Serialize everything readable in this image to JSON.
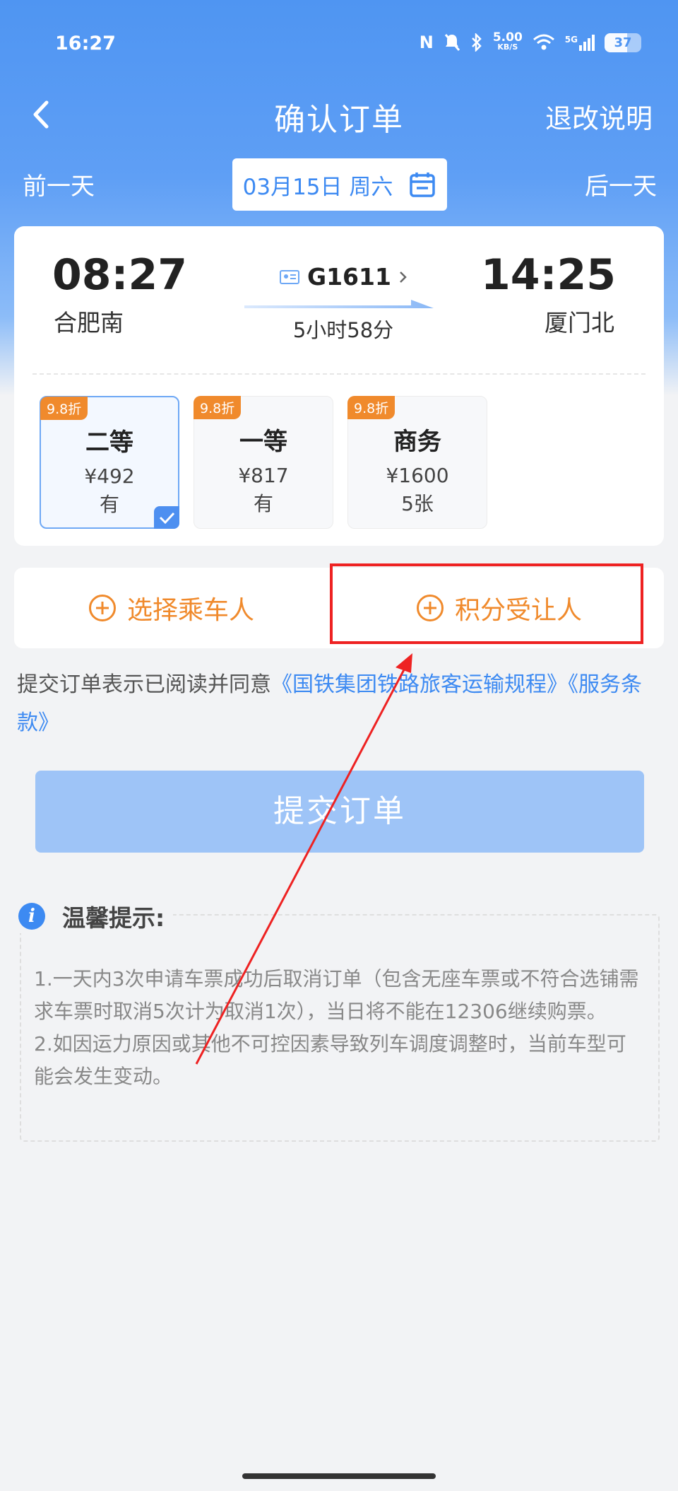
{
  "status_bar": {
    "time": "16:27",
    "speed_value": "5.00",
    "speed_unit": "KB/S",
    "network": "5G",
    "battery": "37"
  },
  "nav": {
    "title": "确认订单",
    "right_link": "退改说明"
  },
  "date_bar": {
    "prev": "前一天",
    "date": "03月15日 周六",
    "next": "后一天"
  },
  "train": {
    "departure_time": "08:27",
    "departure_station": "合肥南",
    "train_number": "G1611",
    "duration": "5小时58分",
    "arrival_time": "14:25",
    "arrival_station": "厦门北"
  },
  "seats": [
    {
      "discount": "9.8折",
      "name": "二等",
      "price": "¥492",
      "availability": "有",
      "selected": true
    },
    {
      "discount": "9.8折",
      "name": "一等",
      "price": "¥817",
      "availability": "有",
      "selected": false
    },
    {
      "discount": "9.8折",
      "name": "商务",
      "price": "¥1600",
      "availability": "5张",
      "selected": false
    }
  ],
  "actions": {
    "select_passenger": "选择乘车人",
    "points_transferee": "积分受让人"
  },
  "agreement": {
    "prefix": "提交订单表示已阅读并同意",
    "link1": "《国铁集团铁路旅客运输规程》",
    "link2": "《服务条款》"
  },
  "submit_label": "提交订单",
  "tips": {
    "title": "温馨提示:",
    "items": [
      "1.一天内3次申请车票成功后取消订单（包含无座车票或不符合选铺需求车票时取消5次计为取消1次），当日将不能在12306继续购票。",
      "2.如因运力原因或其他不可控因素导致列车调度调整时，当前车型可能会发生变动。"
    ]
  },
  "colors": {
    "primary": "#3d8af2",
    "accent_orange": "#f08a2c",
    "annotation_red": "#ee2222",
    "submit_disabled": "#9ec4f7"
  }
}
